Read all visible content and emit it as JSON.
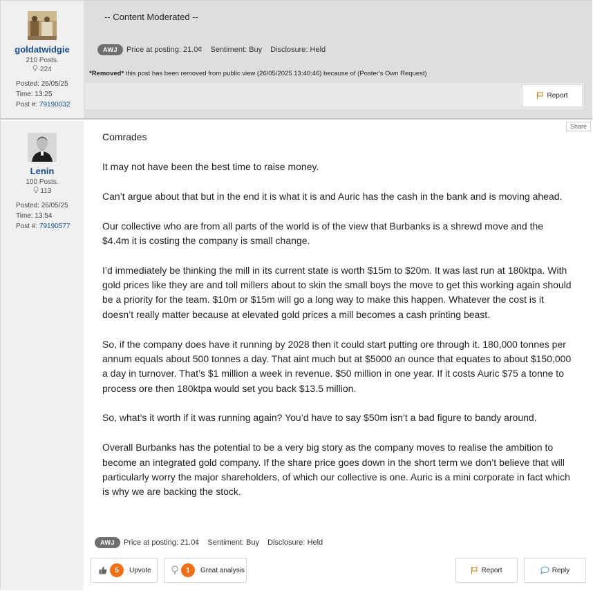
{
  "post1": {
    "username": "goldatwidgie",
    "posts": "210 Posts.",
    "likes": "224",
    "posted": "Posted: 26/05/25",
    "time": "Time: 13:25",
    "post_label": "Post #: ",
    "post_no": "79190032",
    "moderated_text": "-- Content Moderated --",
    "tag": "AWJ",
    "price": "Price at posting: 21.0¢",
    "sentiment": "Sentiment: Buy",
    "disclosure": "Disclosure: Held",
    "removed_prefix": "*Removed*",
    "removed_text": " this post has been removed from public view (26/05/2025 13:40:46) because of (Poster's Own Request)",
    "report_label": "Report"
  },
  "post2": {
    "username": "Lenin",
    "posts": "100 Posts.",
    "likes": "113",
    "posted": "Posted: 26/05/25",
    "time": "Time: 13:54",
    "post_label": "Post #: ",
    "post_no": "79190577",
    "share_label": "Share",
    "paragraphs": [
      "Comrades",
      "It may not have been the best time to raise money.",
      "Can’t argue about that but in the end it is what it is and Auric has the cash in the bank and is moving ahead.",
      "Our collective who are from all parts of the world is of the view that Burbanks is a shrewd move and the $4.4m it is costing the company is small change.",
      "I’d immediately be thinking the mill in its current state is worth $15m to $20m. It was last run at 180ktpa. With gold prices like they are and toll millers about to skin the small boys the move to get this working again should be a priority for the team. $10m or $15m will go a long way to make this happen. Whatever the cost is it doesn’t really matter because at elevated gold prices a mill becomes a cash printing beast.",
      "So, if the company does have it running by 2028 then it could start putting ore through it. 180,000 tonnes per annum equals about 500 tonnes a day. That aint much but at $5000 an ounce that equates to about $150,000 a day in turnover. That’s $1 million a week in revenue. $50 million in one year. If it costs Auric $75 a tonne to process ore then 180ktpa would set you back $13.5 million.",
      "So, what’s it worth if it was running again? You’d have to say $50m isn’t a bad figure to bandy around.",
      "Overall Burbanks has the potential to be a very big story as the company moves to realise the ambition to become an integrated gold company. If the share price goes down in the short term we don’t believe that will particularly worry the major shareholders, of which our collective is one. Auric is a mini corporate in fact which is why we are backing the stock."
    ],
    "tag": "AWJ",
    "price": "Price at posting: 21.0¢",
    "sentiment": "Sentiment: Buy",
    "disclosure": "Disclosure: Held",
    "upvote_count": "5",
    "upvote_label": "Upvote",
    "great_count": "1",
    "great_label": "Great analysis",
    "report_label": "Report",
    "reply_label": "Reply"
  },
  "colors": {
    "accent_orange": "#f07018",
    "username_blue": "#1a4f8b",
    "tag_grey": "#6f6f6f"
  }
}
